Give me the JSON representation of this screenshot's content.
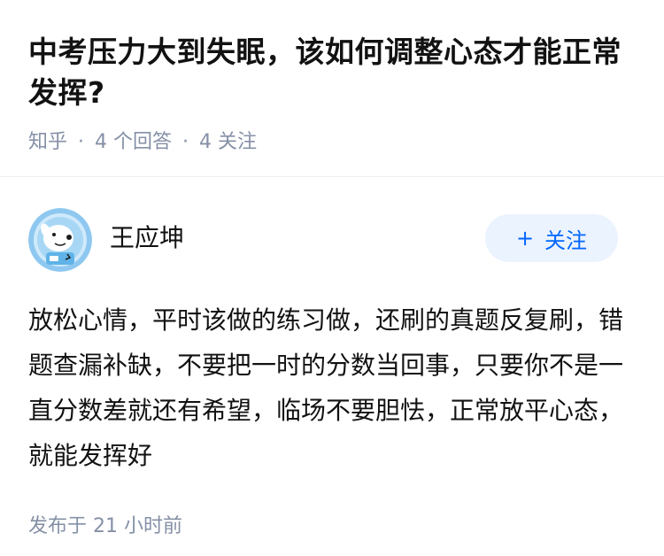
{
  "question": {
    "title": "中考压力大到失眠，该如何调整心态才能正常发挥?",
    "source": "知乎",
    "answer_count": "4 个回答",
    "follow_count": "4 关注",
    "separator": "·"
  },
  "answer": {
    "author_name": "王应坤",
    "follow_label": "关注",
    "follow_plus": "+",
    "content": "放松心情，平时该做的练习做，还刷的真题反复刷，错题查漏补缺，不要把一时的分数当回事，只要你不是一直分数差就还有希望，临场不要胆怯，正常放平心态，就能发挥好",
    "published": "发布于  21 小时前"
  },
  "colors": {
    "accent": "#0066ff",
    "accent_bg": "#ebf3ff",
    "meta_gray": "#8590a6",
    "text": "#121212"
  },
  "icons": {
    "avatar": "dog-astronaut-avatar"
  }
}
